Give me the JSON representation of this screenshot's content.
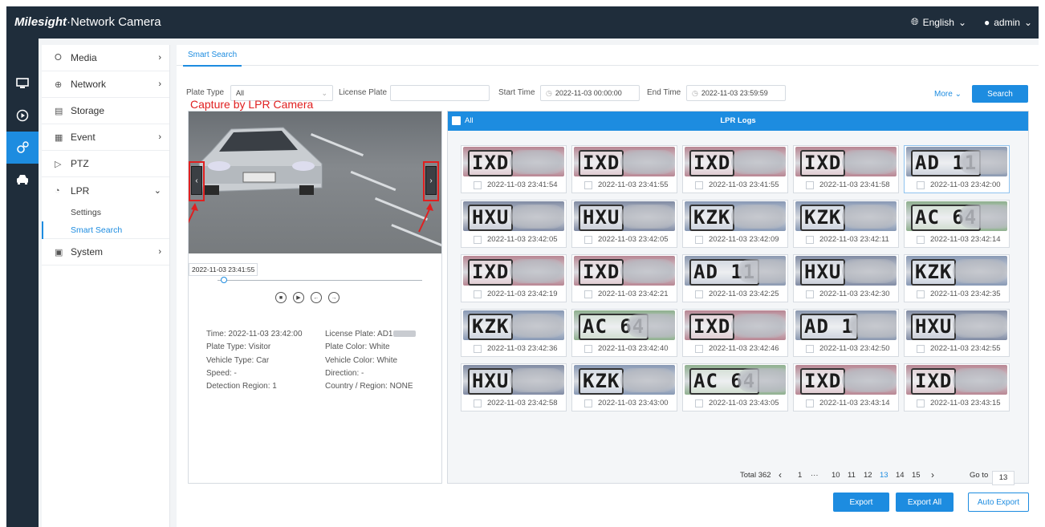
{
  "header": {
    "brand": "Milesight",
    "product": "·Network Camera",
    "language": "English",
    "user": "admin"
  },
  "iconbar": [
    {
      "icon": "monitor-icon"
    },
    {
      "icon": "play-icon"
    },
    {
      "icon": "settings-icon"
    },
    {
      "icon": "car-icon"
    }
  ],
  "sidebar": {
    "items": [
      {
        "label": "Media",
        "icon": "media-icon"
      },
      {
        "label": "Network",
        "icon": "globe-icon"
      },
      {
        "label": "Storage",
        "icon": "storage-icon"
      },
      {
        "label": "Event",
        "icon": "event-icon"
      },
      {
        "label": "PTZ",
        "icon": "ptz-icon"
      },
      {
        "label": "LPR",
        "icon": "car-icon"
      },
      {
        "label": "System",
        "icon": "system-icon"
      }
    ],
    "lpr_sub": [
      {
        "label": "Settings"
      },
      {
        "label": "Smart Search"
      }
    ]
  },
  "tab": {
    "label": "Smart Search"
  },
  "filters": {
    "plate_type_label": "Plate Type",
    "plate_type_value": "All",
    "license_plate_label": "License Plate",
    "license_plate_value": "",
    "start_time_label": "Start Time",
    "start_time_value": "2022-11-03 00:00:00",
    "end_time_label": "End Time",
    "end_time_value": "2022-11-03 23:59:59",
    "more_label": "More",
    "search_label": "Search"
  },
  "annotation": "Capture by LPR Camera",
  "player": {
    "timestamp": "2022-11-03 23:41:55",
    "progress": 0.03
  },
  "details": {
    "time": "Time: 2022-11-03 23:42:00",
    "plate_type": "Plate Type: Visitor",
    "vehicle_type": "Vehicle Type: Car",
    "speed": "Speed: -",
    "detection_region": "Detection Region: 1",
    "license_plate": "License Plate: AD1",
    "plate_color": "Plate Color: White",
    "vehicle_color": "Vehicle Color: White",
    "direction": "Direction: -",
    "country_region": "Country / Region: NONE"
  },
  "logs": {
    "all_label": "All",
    "title": "LPR Logs",
    "items": [
      {
        "plate": "IXD",
        "time": "2022-11-03 23:41:54",
        "color": "#b88592"
      },
      {
        "plate": "IXD",
        "time": "2022-11-03 23:41:55",
        "color": "#b88592"
      },
      {
        "plate": "IXD",
        "time": "2022-11-03 23:41:55",
        "color": "#b88592"
      },
      {
        "plate": "IXD",
        "time": "2022-11-03 23:41:58",
        "color": "#b88592"
      },
      {
        "plate": "AD 11",
        "time": "2022-11-03 23:42:00",
        "color": "#8a98b0"
      },
      {
        "plate": "HXU",
        "time": "2022-11-03 23:42:05",
        "color": "#7f8aa3"
      },
      {
        "plate": "HXU",
        "time": "2022-11-03 23:42:05",
        "color": "#7f8aa3"
      },
      {
        "plate": "KZK",
        "time": "2022-11-03 23:42:09",
        "color": "#8798b4"
      },
      {
        "plate": "KZK",
        "time": "2022-11-03 23:42:11",
        "color": "#8798b4"
      },
      {
        "plate": "AC 64",
        "time": "2022-11-03 23:42:14",
        "color": "#8fb08f"
      },
      {
        "plate": "IXD",
        "time": "2022-11-03 23:42:19",
        "color": "#b88592"
      },
      {
        "plate": "IXD",
        "time": "2022-11-03 23:42:21",
        "color": "#b88592"
      },
      {
        "plate": "AD 11",
        "time": "2022-11-03 23:42:25",
        "color": "#8a98b0"
      },
      {
        "plate": "HXU",
        "time": "2022-11-03 23:42:30",
        "color": "#7f8aa3"
      },
      {
        "plate": "KZK",
        "time": "2022-11-03 23:42:35",
        "color": "#8798b4"
      },
      {
        "plate": "KZK",
        "time": "2022-11-03 23:42:36",
        "color": "#8798b4"
      },
      {
        "plate": "AC 64",
        "time": "2022-11-03 23:42:40",
        "color": "#8fb08f"
      },
      {
        "plate": "IXD",
        "time": "2022-11-03 23:42:46",
        "color": "#b88592"
      },
      {
        "plate": "AD 1",
        "time": "2022-11-03 23:42:50",
        "color": "#8a98b0"
      },
      {
        "plate": "HXU",
        "time": "2022-11-03 23:42:55",
        "color": "#7f8aa3"
      },
      {
        "plate": "HXU",
        "time": "2022-11-03 23:42:58",
        "color": "#7f8aa3"
      },
      {
        "plate": "KZK",
        "time": "2022-11-03 23:43:00",
        "color": "#8798b4"
      },
      {
        "plate": "AC 64",
        "time": "2022-11-03 23:43:05",
        "color": "#8fb08f"
      },
      {
        "plate": "IXD",
        "time": "2022-11-03 23:43:14",
        "color": "#b88592"
      },
      {
        "plate": "IXD",
        "time": "2022-11-03 23:43:15",
        "color": "#b88592"
      }
    ]
  },
  "pagination": {
    "total": "Total 362",
    "prev": "‹",
    "first": "1",
    "ellipsis": "···",
    "pages": [
      "10",
      "11",
      "12",
      "13",
      "14",
      "15"
    ],
    "current": "13",
    "next": "›",
    "goto_label": "Go to",
    "goto_value": "13"
  },
  "actions": {
    "export": "Export",
    "export_all": "Export All",
    "auto_export": "Auto Export"
  },
  "colors": {
    "accent": "#1d8ce0",
    "header_bg": "#1f2d3b",
    "annotation": "#e02020"
  }
}
